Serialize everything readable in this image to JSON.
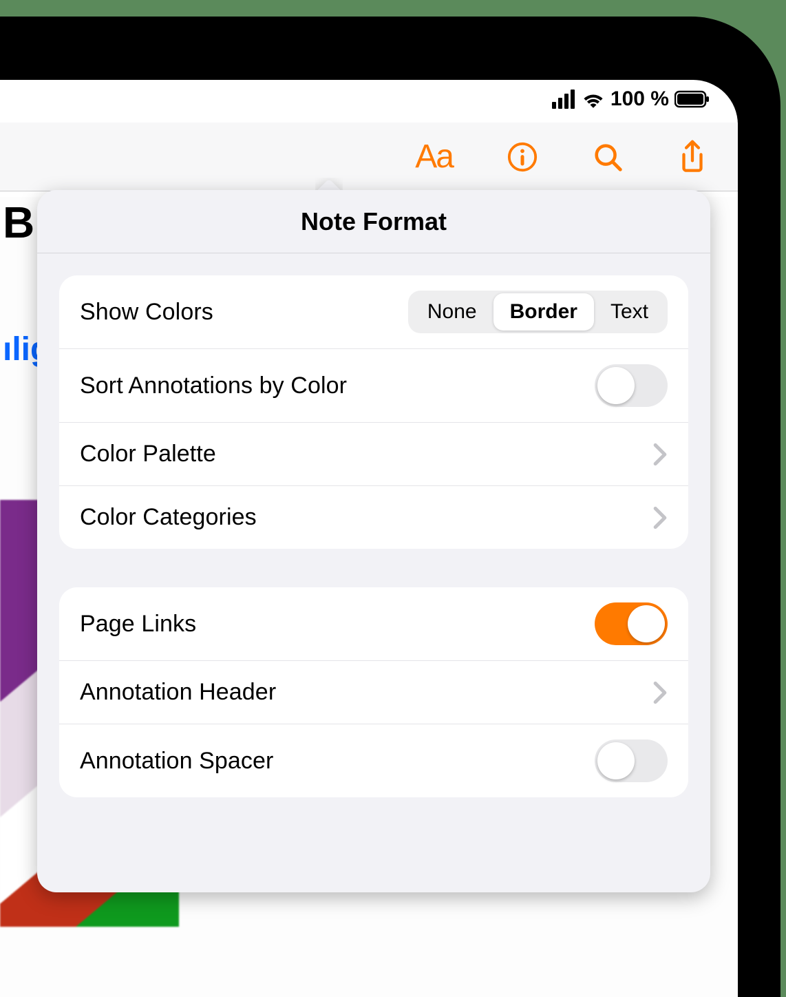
{
  "status": {
    "battery": "100 %"
  },
  "toolbar": {
    "aa_label": "Aa"
  },
  "background": {
    "title_fragment": "Bi",
    "link_fragment": "ılig"
  },
  "popover": {
    "title": "Note Format",
    "group1": {
      "show_colors": {
        "label": "Show Colors",
        "options": [
          "None",
          "Border",
          "Text"
        ],
        "selected": "Border"
      },
      "sort_by_color": {
        "label": "Sort Annotations by Color",
        "value": false
      },
      "color_palette": {
        "label": "Color Palette"
      },
      "color_categories": {
        "label": "Color Categories"
      }
    },
    "group2": {
      "page_links": {
        "label": "Page Links",
        "value": true
      },
      "annotation_header": {
        "label": "Annotation Header"
      },
      "annotation_spacer": {
        "label": "Annotation Spacer",
        "value": false
      }
    }
  }
}
